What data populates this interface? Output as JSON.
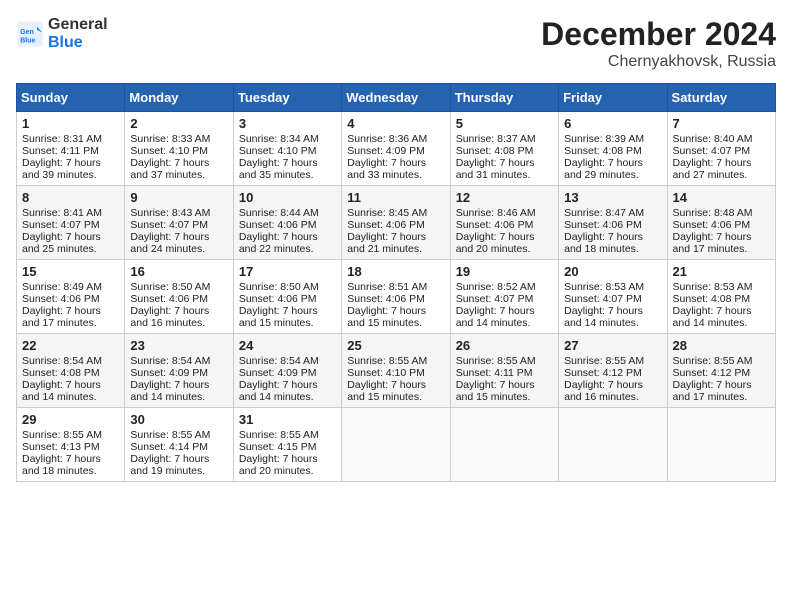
{
  "header": {
    "logo_line1": "General",
    "logo_line2": "Blue",
    "month": "December 2024",
    "location": "Chernyakhovsk, Russia"
  },
  "days_of_week": [
    "Sunday",
    "Monday",
    "Tuesday",
    "Wednesday",
    "Thursday",
    "Friday",
    "Saturday"
  ],
  "weeks": [
    [
      {
        "day": 1,
        "lines": [
          "Sunrise: 8:31 AM",
          "Sunset: 4:11 PM",
          "Daylight: 7 hours",
          "and 39 minutes."
        ]
      },
      {
        "day": 2,
        "lines": [
          "Sunrise: 8:33 AM",
          "Sunset: 4:10 PM",
          "Daylight: 7 hours",
          "and 37 minutes."
        ]
      },
      {
        "day": 3,
        "lines": [
          "Sunrise: 8:34 AM",
          "Sunset: 4:10 PM",
          "Daylight: 7 hours",
          "and 35 minutes."
        ]
      },
      {
        "day": 4,
        "lines": [
          "Sunrise: 8:36 AM",
          "Sunset: 4:09 PM",
          "Daylight: 7 hours",
          "and 33 minutes."
        ]
      },
      {
        "day": 5,
        "lines": [
          "Sunrise: 8:37 AM",
          "Sunset: 4:08 PM",
          "Daylight: 7 hours",
          "and 31 minutes."
        ]
      },
      {
        "day": 6,
        "lines": [
          "Sunrise: 8:39 AM",
          "Sunset: 4:08 PM",
          "Daylight: 7 hours",
          "and 29 minutes."
        ]
      },
      {
        "day": 7,
        "lines": [
          "Sunrise: 8:40 AM",
          "Sunset: 4:07 PM",
          "Daylight: 7 hours",
          "and 27 minutes."
        ]
      }
    ],
    [
      {
        "day": 8,
        "lines": [
          "Sunrise: 8:41 AM",
          "Sunset: 4:07 PM",
          "Daylight: 7 hours",
          "and 25 minutes."
        ]
      },
      {
        "day": 9,
        "lines": [
          "Sunrise: 8:43 AM",
          "Sunset: 4:07 PM",
          "Daylight: 7 hours",
          "and 24 minutes."
        ]
      },
      {
        "day": 10,
        "lines": [
          "Sunrise: 8:44 AM",
          "Sunset: 4:06 PM",
          "Daylight: 7 hours",
          "and 22 minutes."
        ]
      },
      {
        "day": 11,
        "lines": [
          "Sunrise: 8:45 AM",
          "Sunset: 4:06 PM",
          "Daylight: 7 hours",
          "and 21 minutes."
        ]
      },
      {
        "day": 12,
        "lines": [
          "Sunrise: 8:46 AM",
          "Sunset: 4:06 PM",
          "Daylight: 7 hours",
          "and 20 minutes."
        ]
      },
      {
        "day": 13,
        "lines": [
          "Sunrise: 8:47 AM",
          "Sunset: 4:06 PM",
          "Daylight: 7 hours",
          "and 18 minutes."
        ]
      },
      {
        "day": 14,
        "lines": [
          "Sunrise: 8:48 AM",
          "Sunset: 4:06 PM",
          "Daylight: 7 hours",
          "and 17 minutes."
        ]
      }
    ],
    [
      {
        "day": 15,
        "lines": [
          "Sunrise: 8:49 AM",
          "Sunset: 4:06 PM",
          "Daylight: 7 hours",
          "and 17 minutes."
        ]
      },
      {
        "day": 16,
        "lines": [
          "Sunrise: 8:50 AM",
          "Sunset: 4:06 PM",
          "Daylight: 7 hours",
          "and 16 minutes."
        ]
      },
      {
        "day": 17,
        "lines": [
          "Sunrise: 8:50 AM",
          "Sunset: 4:06 PM",
          "Daylight: 7 hours",
          "and 15 minutes."
        ]
      },
      {
        "day": 18,
        "lines": [
          "Sunrise: 8:51 AM",
          "Sunset: 4:06 PM",
          "Daylight: 7 hours",
          "and 15 minutes."
        ]
      },
      {
        "day": 19,
        "lines": [
          "Sunrise: 8:52 AM",
          "Sunset: 4:07 PM",
          "Daylight: 7 hours",
          "and 14 minutes."
        ]
      },
      {
        "day": 20,
        "lines": [
          "Sunrise: 8:53 AM",
          "Sunset: 4:07 PM",
          "Daylight: 7 hours",
          "and 14 minutes."
        ]
      },
      {
        "day": 21,
        "lines": [
          "Sunrise: 8:53 AM",
          "Sunset: 4:08 PM",
          "Daylight: 7 hours",
          "and 14 minutes."
        ]
      }
    ],
    [
      {
        "day": 22,
        "lines": [
          "Sunrise: 8:54 AM",
          "Sunset: 4:08 PM",
          "Daylight: 7 hours",
          "and 14 minutes."
        ]
      },
      {
        "day": 23,
        "lines": [
          "Sunrise: 8:54 AM",
          "Sunset: 4:09 PM",
          "Daylight: 7 hours",
          "and 14 minutes."
        ]
      },
      {
        "day": 24,
        "lines": [
          "Sunrise: 8:54 AM",
          "Sunset: 4:09 PM",
          "Daylight: 7 hours",
          "and 14 minutes."
        ]
      },
      {
        "day": 25,
        "lines": [
          "Sunrise: 8:55 AM",
          "Sunset: 4:10 PM",
          "Daylight: 7 hours",
          "and 15 minutes."
        ]
      },
      {
        "day": 26,
        "lines": [
          "Sunrise: 8:55 AM",
          "Sunset: 4:11 PM",
          "Daylight: 7 hours",
          "and 15 minutes."
        ]
      },
      {
        "day": 27,
        "lines": [
          "Sunrise: 8:55 AM",
          "Sunset: 4:12 PM",
          "Daylight: 7 hours",
          "and 16 minutes."
        ]
      },
      {
        "day": 28,
        "lines": [
          "Sunrise: 8:55 AM",
          "Sunset: 4:12 PM",
          "Daylight: 7 hours",
          "and 17 minutes."
        ]
      }
    ],
    [
      {
        "day": 29,
        "lines": [
          "Sunrise: 8:55 AM",
          "Sunset: 4:13 PM",
          "Daylight: 7 hours",
          "and 18 minutes."
        ]
      },
      {
        "day": 30,
        "lines": [
          "Sunrise: 8:55 AM",
          "Sunset: 4:14 PM",
          "Daylight: 7 hours",
          "and 19 minutes."
        ]
      },
      {
        "day": 31,
        "lines": [
          "Sunrise: 8:55 AM",
          "Sunset: 4:15 PM",
          "Daylight: 7 hours",
          "and 20 minutes."
        ]
      },
      null,
      null,
      null,
      null
    ]
  ]
}
